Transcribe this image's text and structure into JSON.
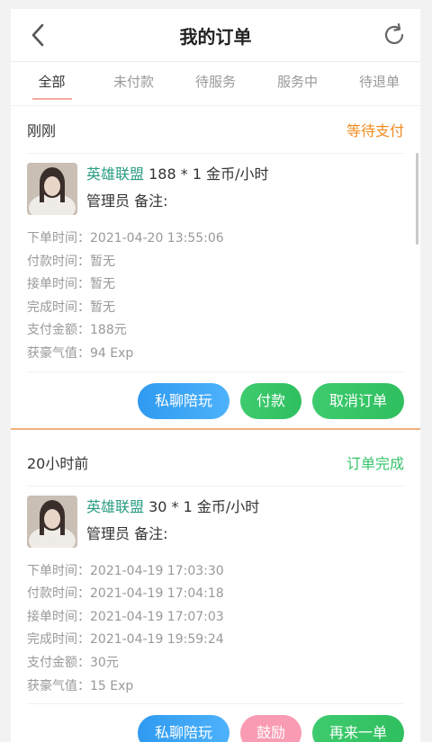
{
  "header": {
    "title": "我的订单",
    "back_icon": "chevron-left-icon",
    "refresh_icon": "refresh-icon"
  },
  "tabs": [
    {
      "label": "全部",
      "active": true
    },
    {
      "label": "未付款",
      "active": false
    },
    {
      "label": "待服务",
      "active": false
    },
    {
      "label": "服务中",
      "active": false
    },
    {
      "label": "待退单",
      "active": false
    }
  ],
  "orders": [
    {
      "time": "刚刚",
      "status": "等待支付",
      "status_color": "#f08c1f",
      "game": "英雄联盟",
      "spec": " 188 * 1 金币/小时",
      "admin_note": "管理员 备注:",
      "info": [
        "下单时间：2021-04-20 13:55:06",
        "付款时间：暂无",
        "接单时间：暂无",
        "完成时间：暂无",
        "支付金额：188元",
        "获豪气值：94 Exp"
      ],
      "buttons": [
        "私聊陪玩",
        "付款",
        "取消订单"
      ]
    },
    {
      "time": "20小时前",
      "status": "订单完成",
      "status_color": "#35c46a",
      "game": "英雄联盟",
      "spec": " 30 * 1 金币/小时",
      "admin_note": "管理员 备注:",
      "info": [
        "下单时间：2021-04-19 17:03:30",
        "付款时间：2021-04-19 17:04:18",
        "接单时间：2021-04-19 17:07:03",
        "完成时间：2021-04-19 19:59:24",
        "支付金额：30元",
        "获豪气值：15 Exp"
      ],
      "buttons": [
        "私聊陪玩",
        "鼓励",
        "再来一单"
      ]
    }
  ]
}
